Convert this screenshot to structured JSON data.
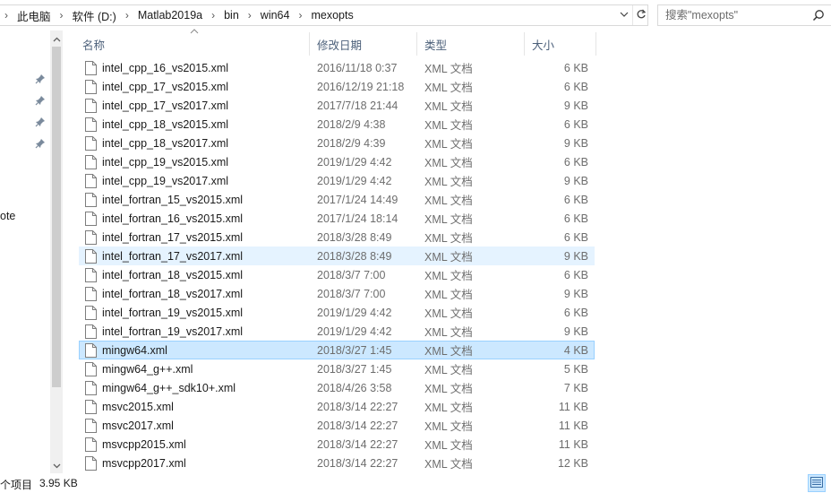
{
  "address": {
    "crumbs": [
      "此电脑",
      "软件 (D:)",
      "Matlab2019a",
      "bin",
      "win64",
      "mexopts"
    ],
    "separator": "›"
  },
  "search": {
    "placeholder": "搜索\"mexopts\""
  },
  "nav": {
    "partial_label": "ote"
  },
  "columns": {
    "name": "名称",
    "date": "修改日期",
    "type": "类型",
    "size": "大小"
  },
  "files": [
    {
      "name": "intel_cpp_16_vs2015.xml",
      "date": "2016/11/18 0:37",
      "type": "XML 文档",
      "size": "6 KB"
    },
    {
      "name": "intel_cpp_17_vs2015.xml",
      "date": "2016/12/19 21:18",
      "type": "XML 文档",
      "size": "6 KB"
    },
    {
      "name": "intel_cpp_17_vs2017.xml",
      "date": "2017/7/18 21:44",
      "type": "XML 文档",
      "size": "9 KB"
    },
    {
      "name": "intel_cpp_18_vs2015.xml",
      "date": "2018/2/9 4:38",
      "type": "XML 文档",
      "size": "6 KB"
    },
    {
      "name": "intel_cpp_18_vs2017.xml",
      "date": "2018/2/9 4:39",
      "type": "XML 文档",
      "size": "9 KB"
    },
    {
      "name": "intel_cpp_19_vs2015.xml",
      "date": "2019/1/29 4:42",
      "type": "XML 文档",
      "size": "6 KB"
    },
    {
      "name": "intel_cpp_19_vs2017.xml",
      "date": "2019/1/29 4:42",
      "type": "XML 文档",
      "size": "9 KB"
    },
    {
      "name": "intel_fortran_15_vs2015.xml",
      "date": "2017/1/24 14:49",
      "type": "XML 文档",
      "size": "6 KB"
    },
    {
      "name": "intel_fortran_16_vs2015.xml",
      "date": "2017/1/24 18:14",
      "type": "XML 文档",
      "size": "6 KB"
    },
    {
      "name": "intel_fortran_17_vs2015.xml",
      "date": "2018/3/28 8:49",
      "type": "XML 文档",
      "size": "6 KB"
    },
    {
      "name": "intel_fortran_17_vs2017.xml",
      "date": "2018/3/28 8:49",
      "type": "XML 文档",
      "size": "9 KB",
      "state": "hover"
    },
    {
      "name": "intel_fortran_18_vs2015.xml",
      "date": "2018/3/7 7:00",
      "type": "XML 文档",
      "size": "6 KB"
    },
    {
      "name": "intel_fortran_18_vs2017.xml",
      "date": "2018/3/7 7:00",
      "type": "XML 文档",
      "size": "9 KB"
    },
    {
      "name": "intel_fortran_19_vs2015.xml",
      "date": "2019/1/29 4:42",
      "type": "XML 文档",
      "size": "6 KB"
    },
    {
      "name": "intel_fortran_19_vs2017.xml",
      "date": "2019/1/29 4:42",
      "type": "XML 文档",
      "size": "9 KB"
    },
    {
      "name": "mingw64.xml",
      "date": "2018/3/27 1:45",
      "type": "XML 文档",
      "size": "4 KB",
      "state": "selected"
    },
    {
      "name": "mingw64_g++.xml",
      "date": "2018/3/27 1:45",
      "type": "XML 文档",
      "size": "5 KB"
    },
    {
      "name": "mingw64_g++_sdk10+.xml",
      "date": "2018/4/26 3:58",
      "type": "XML 文档",
      "size": "7 KB"
    },
    {
      "name": "msvc2015.xml",
      "date": "2018/3/14 22:27",
      "type": "XML 文档",
      "size": "11 KB"
    },
    {
      "name": "msvc2017.xml",
      "date": "2018/3/14 22:27",
      "type": "XML 文档",
      "size": "11 KB"
    },
    {
      "name": "msvcpp2015.xml",
      "date": "2018/3/14 22:27",
      "type": "XML 文档",
      "size": "11 KB"
    },
    {
      "name": "msvcpp2017.xml",
      "date": "2018/3/14 22:27",
      "type": "XML 文档",
      "size": "12 KB"
    }
  ],
  "status": {
    "count_text": "个项目",
    "selected_size": "3.95 KB"
  },
  "icons": {
    "file": "document-icon",
    "pin": "pin-icon",
    "search": "search-icon",
    "refresh": "refresh-icon",
    "dropdown": "chevron-down-icon"
  },
  "colors": {
    "selected_bg": "#cce8ff",
    "selected_border": "#99d1ff",
    "hover_bg": "#e5f3ff",
    "header_text": "#4c607a"
  }
}
